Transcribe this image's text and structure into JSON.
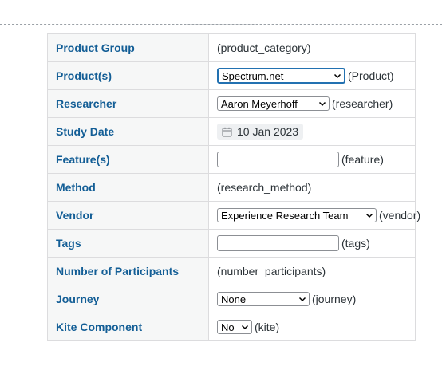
{
  "fields": {
    "product_group": {
      "label": "Product Group",
      "value": "(product_category)"
    },
    "products": {
      "label": "Product(s)",
      "selected": "Spectrum.net",
      "suffix": "(Product)"
    },
    "researcher": {
      "label": "Researcher",
      "selected": "Aaron Meyerhoff",
      "suffix": "(researcher)"
    },
    "study_date": {
      "label": "Study Date",
      "value": "10 Jan 2023",
      "icon": "calendar-icon"
    },
    "features": {
      "label": "Feature(s)",
      "value": "",
      "suffix": "(feature)"
    },
    "method": {
      "label": "Method",
      "value": "(research_method)"
    },
    "vendor": {
      "label": "Vendor",
      "selected": "Experience Research Team",
      "suffix": "(vendor)"
    },
    "tags": {
      "label": "Tags",
      "value": "",
      "suffix": "(tags)"
    },
    "participants": {
      "label": "Number of Participants",
      "value": "(number_participants)"
    },
    "journey": {
      "label": "Journey",
      "selected": "None",
      "suffix": "(journey)"
    },
    "kite_component": {
      "label": "Kite Component",
      "selected": "No",
      "suffix": "(kite)"
    }
  },
  "colors": {
    "label_text": "#135e96",
    "label_bg": "#f6f7f7",
    "border": "#dcdcde",
    "focus": "#2271b1"
  }
}
